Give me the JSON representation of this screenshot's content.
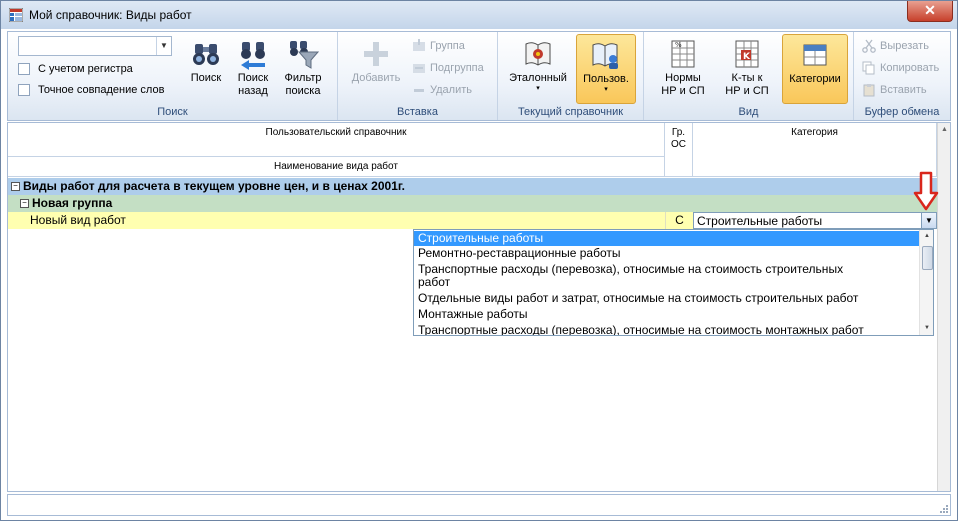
{
  "window": {
    "title": "Мой справочник: Виды работ",
    "close_glyph": "✕"
  },
  "ribbon": {
    "search": {
      "combo_value": "",
      "case_checkbox": "С учетом регистра",
      "exact_checkbox": "Точное совпадение слов",
      "btn_search": "Поиск",
      "btn_search_back_1": "Поиск",
      "btn_search_back_2": "назад",
      "btn_filter_1": "Фильтр",
      "btn_filter_2": "поиска",
      "label": "Поиск"
    },
    "insert": {
      "btn_add": "Добавить",
      "btn_group": "Группа",
      "btn_subgroup": "Подгруппа",
      "btn_delete": "Удалить",
      "label": "Вставка"
    },
    "current": {
      "btn_reference": "Эталонный",
      "btn_user": "Пользов.",
      "label": "Текущий справочник"
    },
    "view": {
      "btn_norms_1": "Нормы",
      "btn_norms_2": "НР и СП",
      "btn_coef_1": "К-ты к",
      "btn_coef_2": "НР и СП",
      "btn_categories": "Категории",
      "label": "Вид"
    },
    "clipboard": {
      "btn_cut": "Вырезать",
      "btn_copy": "Копировать",
      "btn_paste": "Вставить",
      "label": "Буфер обмена"
    }
  },
  "grid": {
    "header_user_ref": "Пользовательский справочник",
    "header_name": "Наименование вида работ",
    "header_gr_1": "Гр.",
    "header_gr_2": "ОС",
    "header_category": "Категория",
    "group1": "Виды работ для расчета в текущем уровне цен, и в ценах 2001г.",
    "group2": "Новая группа",
    "row": {
      "name": "Новый вид работ",
      "gr": "С",
      "category": "Строительные работы"
    }
  },
  "dropdown": {
    "items": [
      "Строительные работы",
      "Ремонтно-реставрационные работы",
      "Транспортные расходы (перевозка), относимые на стоимость строительных",
      "работ",
      "Отдельные виды работ и затрат, относимые на стоимость строительных работ",
      "Монтажные работы",
      "Транспортные расходы (перевозка), относимые на стоимость монтажных работ"
    ]
  }
}
